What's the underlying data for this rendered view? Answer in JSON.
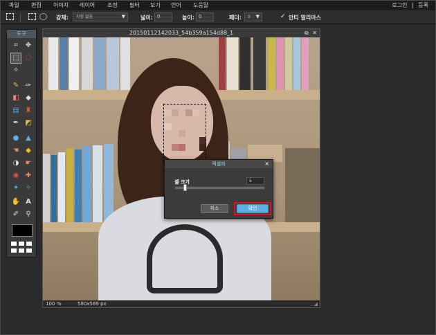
{
  "menubar": {
    "items": [
      "파일",
      "편집",
      "이미지",
      "레이어",
      "조정",
      "필터",
      "보기",
      "언어",
      "도움말"
    ],
    "right_login": "로그인",
    "right_sep": "|",
    "right_register": "등록"
  },
  "options": {
    "strength_label": "강제:",
    "strength_value": "지정 없음",
    "width_label": "넓이:",
    "width_value": "0",
    "height_label": "높이:",
    "height_value": "0",
    "feather_label": "페더:",
    "feather_value": "0",
    "check_mark": "✓",
    "antialias_label": "안티 알리아스"
  },
  "tools": {
    "title": "도구"
  },
  "document": {
    "title": "20150112142033_54b359a154d88_1",
    "restore_icon": "⧉",
    "close_icon": "✕",
    "zoom": "100",
    "zoom_unit": "%",
    "size": "580x569 px"
  },
  "dialog": {
    "title": "픽셀화",
    "close_icon": "×",
    "cell_size_label": "셀 크기",
    "cell_size_value": "5",
    "slider_fraction": 0.1,
    "cancel_label": "취소",
    "ok_label": "확인"
  },
  "colors": {
    "accent": "#5ab0e0",
    "highlight": "#e0101c",
    "foreground": "#000000"
  }
}
